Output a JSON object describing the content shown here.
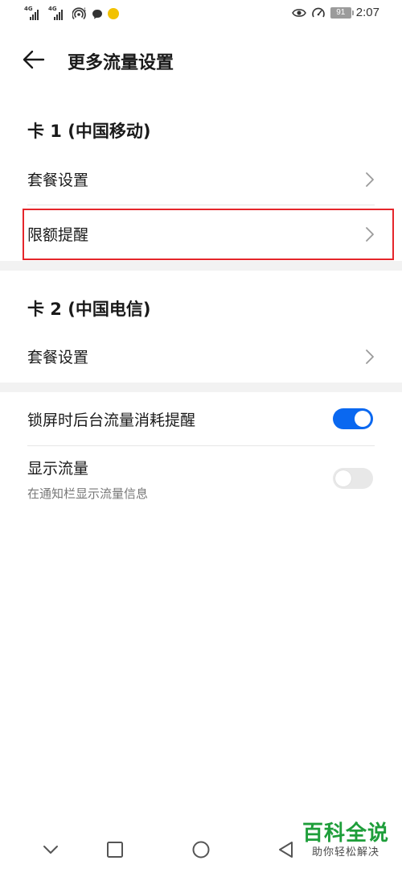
{
  "status_bar": {
    "signal_1_label": "4G",
    "signal_2_label": "4G",
    "hotspot_count": "1",
    "battery": "91",
    "time": "2:07"
  },
  "header": {
    "title": "更多流量设置"
  },
  "sim1": {
    "title": "卡 1 (中国移动)",
    "items": [
      {
        "label": "套餐设置"
      },
      {
        "label": "限额提醒"
      }
    ]
  },
  "sim2": {
    "title": "卡 2 (中国电信)",
    "items": [
      {
        "label": "套餐设置"
      }
    ]
  },
  "settings": {
    "lockscreen_reminder": {
      "label": "锁屏时后台流量消耗提醒",
      "enabled": true
    },
    "show_usage": {
      "label": "显示流量",
      "subtitle": "在通知栏显示流量信息",
      "enabled": false
    }
  },
  "colors": {
    "accent": "#0a68f0",
    "highlight_border": "#e5262b",
    "watermark_green": "#1e9e3a"
  },
  "watermark": {
    "title": "百科全说",
    "subtitle": "助你轻松解决"
  }
}
